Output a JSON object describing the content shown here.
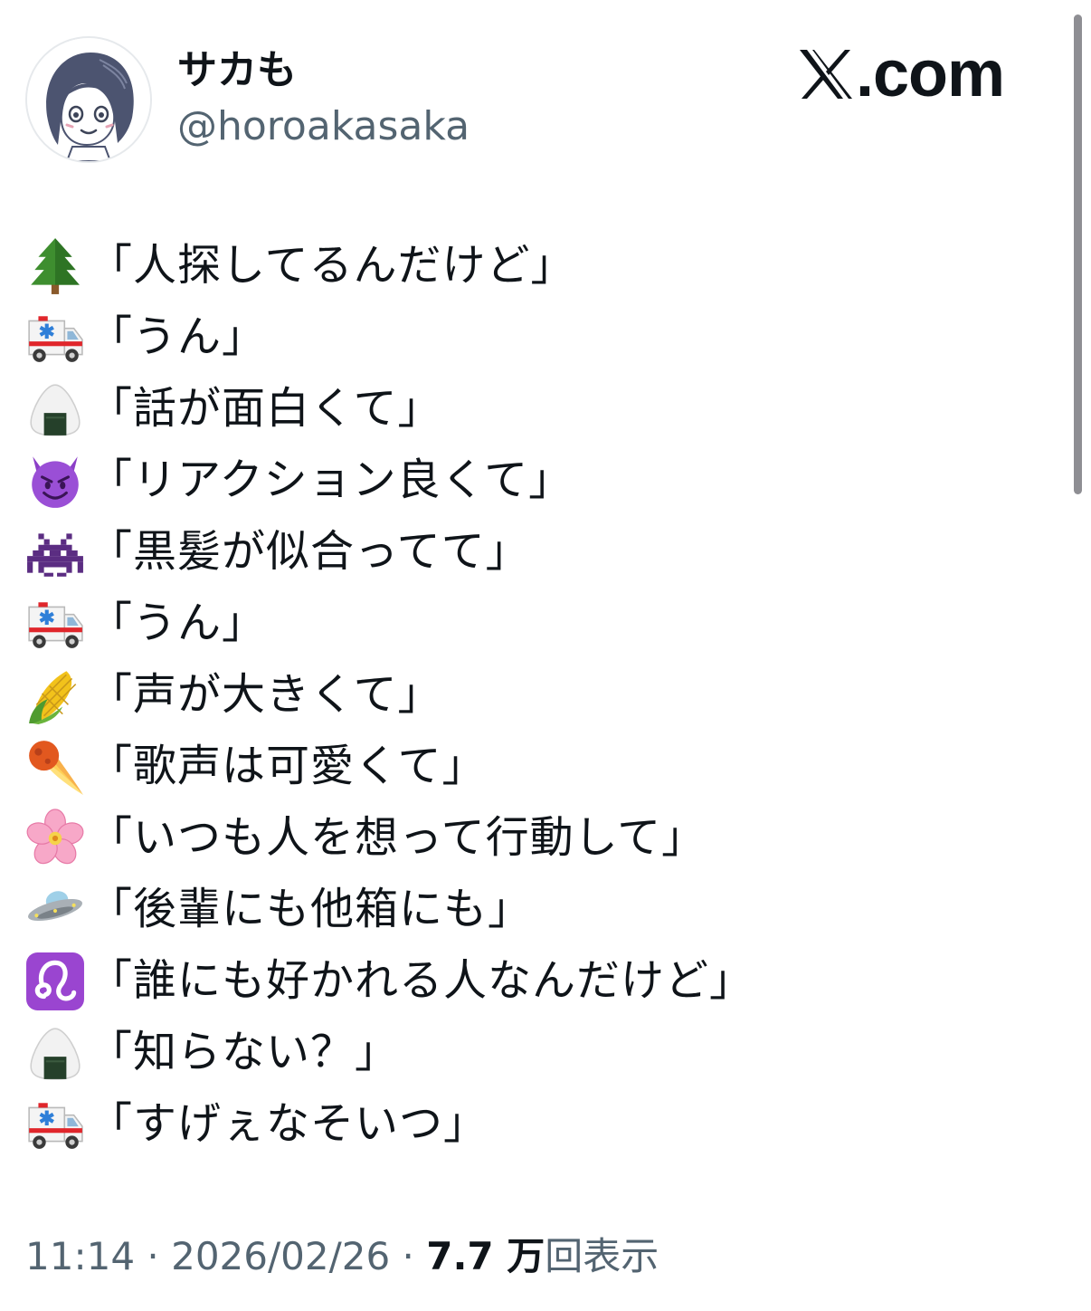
{
  "author": {
    "display_name": "サカも",
    "handle": "@horoakasaka",
    "avatar_icon": "avatar-illustration-icon"
  },
  "brand": {
    "logo_icon": "x-logo-icon",
    "text": ".com"
  },
  "tweet": {
    "lines": [
      {
        "emoji": "evergreen-tree-icon",
        "text": "「人探してるんだけど」"
      },
      {
        "emoji": "ambulance-icon",
        "text": "「うん」"
      },
      {
        "emoji": "rice-ball-icon",
        "text": "「話が面白くて」"
      },
      {
        "emoji": "smiling-devil-icon",
        "text": "「リアクション良くて」"
      },
      {
        "emoji": "space-invader-icon",
        "text": "「黒髪が似合ってて」"
      },
      {
        "emoji": "ambulance-icon",
        "text": "「うん」"
      },
      {
        "emoji": "corn-icon",
        "text": "「声が大きくて」"
      },
      {
        "emoji": "comet-icon",
        "text": "「歌声は可愛くて」"
      },
      {
        "emoji": "cherry-blossom-icon",
        "text": "「いつも人を想って行動して」"
      },
      {
        "emoji": "ufo-icon",
        "text": "「後輩にも他箱にも」"
      },
      {
        "emoji": "leo-sign-icon",
        "text": "「誰にも好かれる人なんだけど」"
      },
      {
        "emoji": "rice-ball-icon",
        "text": "「知らない？」"
      },
      {
        "emoji": "ambulance-icon",
        "text": "「すげぇなそいつ」"
      }
    ]
  },
  "meta": {
    "time": "11:14",
    "separator": " · ",
    "date": "2026/02/26",
    "views_count": "7.7 万",
    "views_label": "回表示"
  },
  "colors": {
    "text_primary": "#0f1419",
    "text_secondary": "#536471",
    "background": "#ffffff",
    "scrollbar": "#8e8e93"
  }
}
